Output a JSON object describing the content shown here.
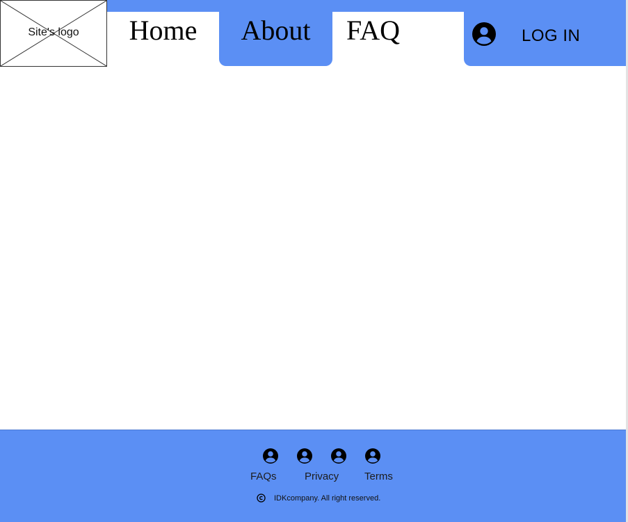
{
  "header": {
    "logo_text": "Site's logo",
    "nav": [
      {
        "label": "Home"
      },
      {
        "label": "About"
      },
      {
        "label": "FAQ"
      }
    ],
    "login": {
      "label": "LOG IN",
      "icon": "account-circle-icon"
    }
  },
  "footer": {
    "icons": [
      "account-circle-icon",
      "account-circle-icon",
      "account-circle-icon",
      "account-circle-icon"
    ],
    "links": [
      {
        "label": "FAQs"
      },
      {
        "label": "Privacy"
      },
      {
        "label": "Terms"
      }
    ],
    "copyright_icon": "copyright-icon",
    "copyright_text": "IDKcompany. All right reserved."
  },
  "colors": {
    "accent": "#5b8ff4",
    "background": "#ffffff",
    "text": "#000000"
  }
}
